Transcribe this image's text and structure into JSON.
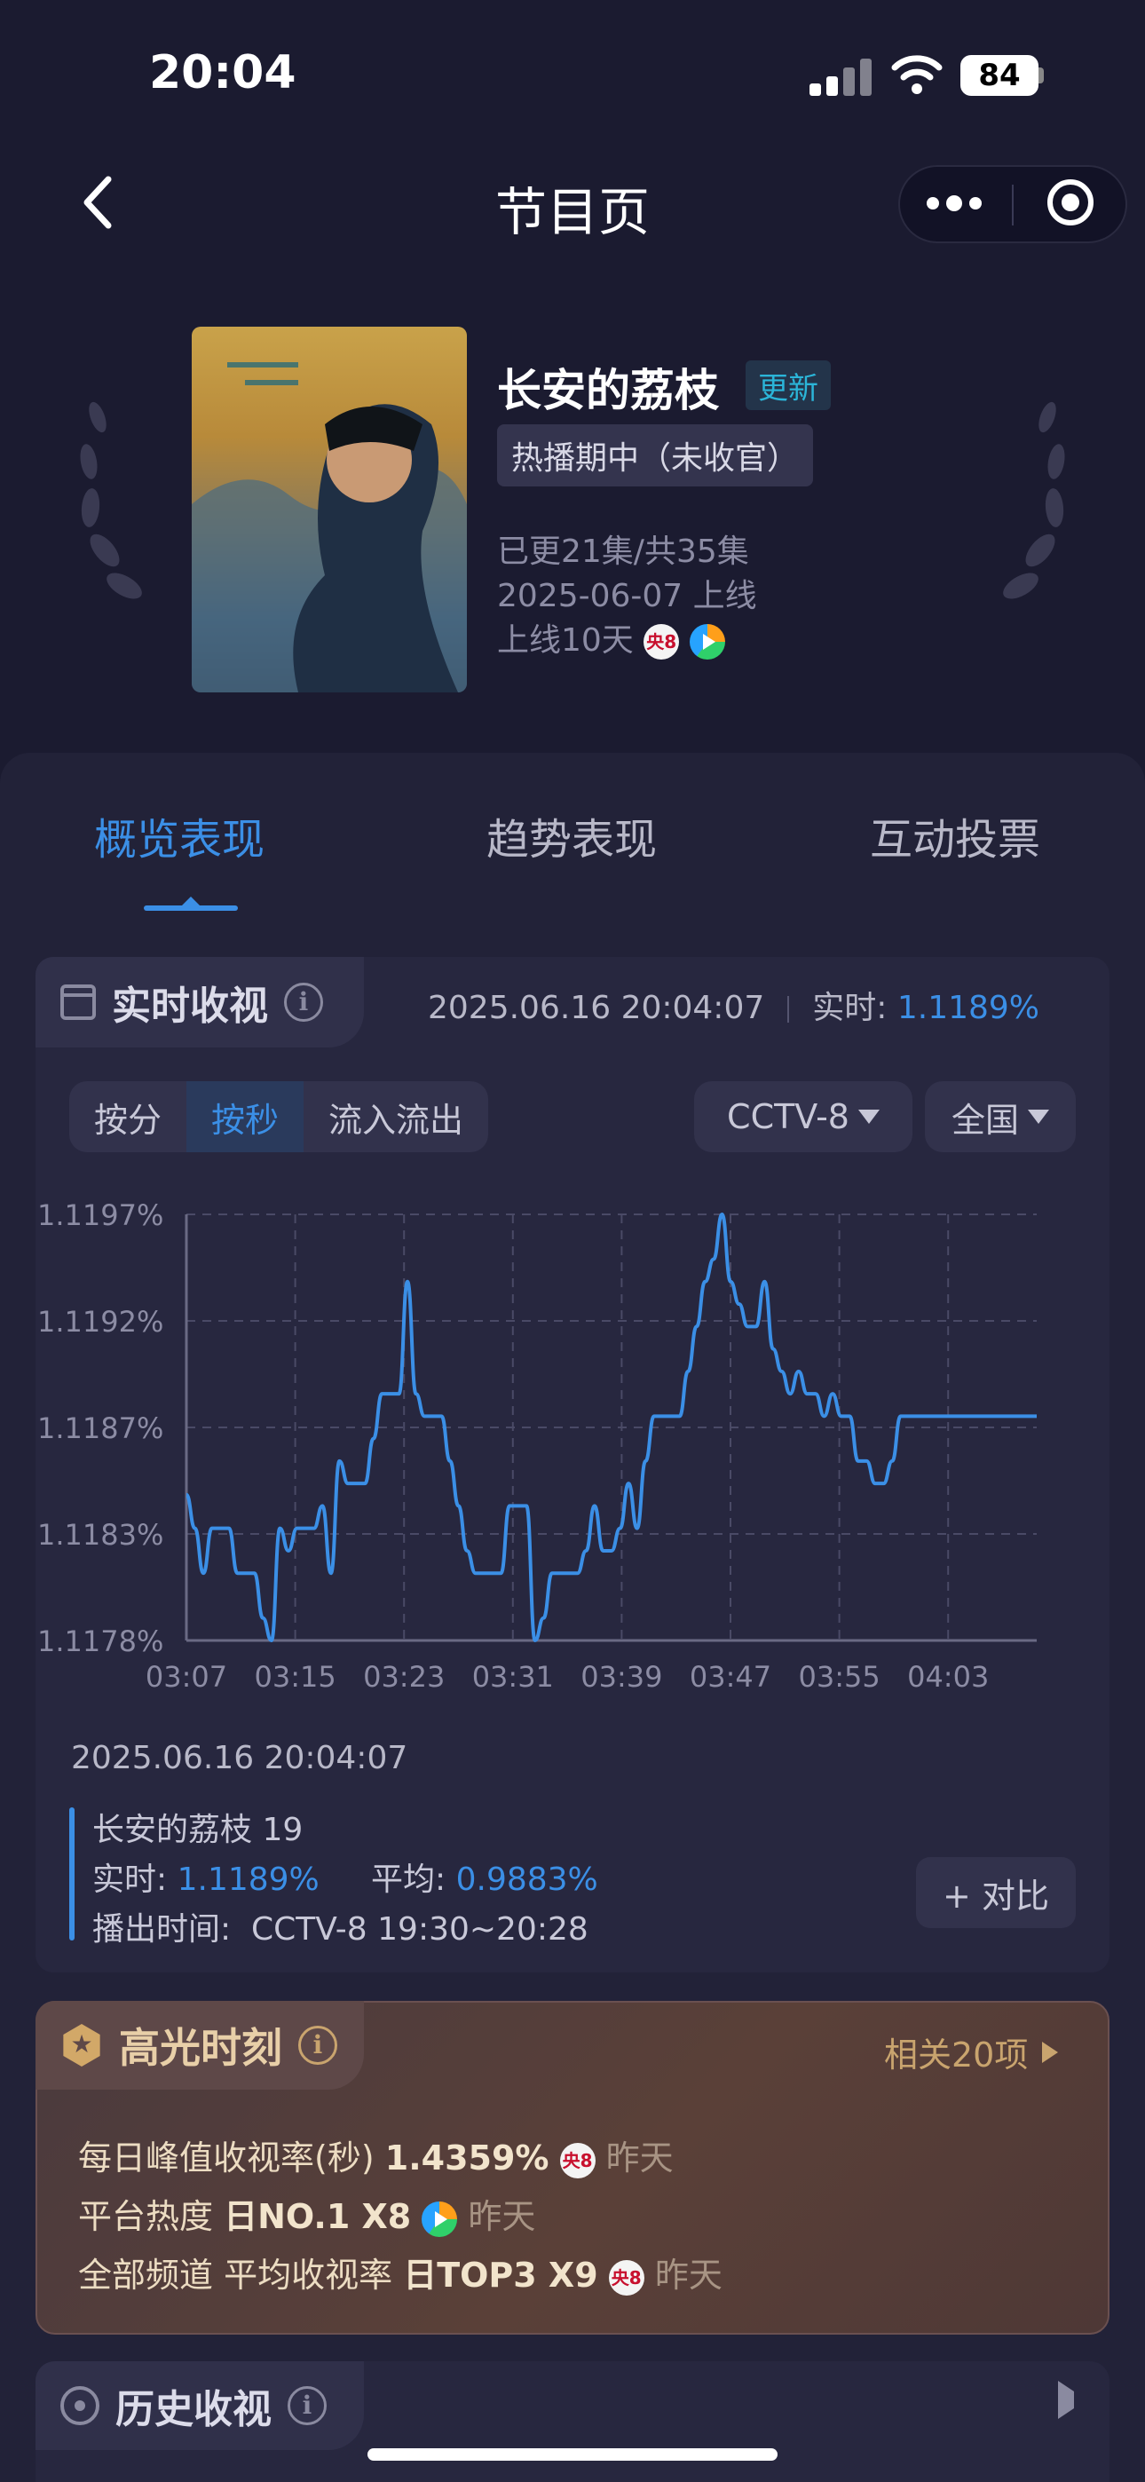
{
  "status": {
    "time": "20:04",
    "battery": "84"
  },
  "nav": {
    "title": "节目页",
    "back": "back-icon",
    "more": "more-icon",
    "target": "target-icon"
  },
  "show": {
    "title": "长安的荔枝",
    "update_tag": "更新",
    "status": "热播期中（未收官）",
    "episodes": "已更21集/共35集",
    "premiere": "2025-06-07 上线",
    "days": "上线10天",
    "channel_badge": "央8"
  },
  "tabs": [
    "概览表现",
    "趋势表现",
    "互动投票"
  ],
  "realtime": {
    "title": "实时收视",
    "datetime": "2025.06.16 20:04:07",
    "label": "实时:",
    "value": "1.1189%"
  },
  "controls": {
    "segments": [
      "按分",
      "按秒",
      "流入流出"
    ],
    "active_segment": "按秒",
    "channel": "CCTV-8",
    "region": "全国"
  },
  "chart_data": {
    "type": "line",
    "y_ticks": [
      "1.1197%",
      "1.1192%",
      "1.1187%",
      "1.1183%",
      "1.1178%"
    ],
    "x_ticks": [
      "03:07",
      "03:15",
      "03:23",
      "03:31",
      "03:39",
      "03:47",
      "03:55",
      "04:03"
    ],
    "ylim": [
      1.1178,
      1.1197
    ],
    "xlim": [
      3.07,
      4.07
    ],
    "grid": true,
    "color": "#3b8fe6",
    "series": [
      {
        "x": [
          3.07,
          3.08,
          3.09,
          3.1,
          3.11,
          3.12,
          3.13,
          3.14,
          3.15,
          3.16,
          3.17,
          3.18,
          3.19,
          3.2,
          3.21,
          3.22,
          3.23,
          3.24,
          3.25,
          3.26,
          3.27,
          3.28,
          3.29,
          3.3,
          3.31,
          3.32,
          3.33,
          3.34,
          3.35,
          3.36,
          3.37,
          3.38,
          3.39,
          3.4,
          3.41,
          3.42,
          3.43,
          3.44,
          3.45,
          3.46,
          3.47,
          3.48,
          3.49,
          3.5,
          3.51,
          3.52,
          3.53,
          3.54,
          3.55,
          3.56,
          3.57,
          3.58,
          3.59,
          3.6,
          3.61,
          3.62,
          3.63,
          3.64,
          3.65,
          3.66,
          3.67,
          3.68,
          3.69,
          3.7,
          3.71,
          3.72,
          3.73,
          3.74,
          3.75,
          3.76,
          3.77,
          3.78,
          3.79,
          3.8,
          3.81,
          3.82,
          3.83,
          3.84,
          3.85,
          3.86,
          3.87,
          3.88,
          3.89,
          3.9,
          3.91,
          3.92,
          3.93,
          3.94,
          3.95,
          3.96,
          3.97,
          3.98,
          3.99,
          4.0,
          4.01,
          4.02,
          4.03,
          4.04,
          4.05,
          4.06,
          4.07
        ],
        "y": [
          1.11845,
          1.1183,
          1.1181,
          1.1183,
          1.1183,
          1.1183,
          1.1181,
          1.1181,
          1.1181,
          1.1179,
          1.1178,
          1.1183,
          1.1182,
          1.1183,
          1.1183,
          1.1183,
          1.1184,
          1.1181,
          1.1186,
          1.1185,
          1.1185,
          1.1185,
          1.1187,
          1.1189,
          1.1189,
          1.1189,
          1.1194,
          1.1189,
          1.1188,
          1.1188,
          1.1188,
          1.1186,
          1.1184,
          1.1182,
          1.1181,
          1.1181,
          1.1181,
          1.1181,
          1.1184,
          1.1184,
          1.1184,
          1.1178,
          1.1179,
          1.1181,
          1.1181,
          1.1181,
          1.1181,
          1.1182,
          1.1184,
          1.1182,
          1.1182,
          1.1183,
          1.1185,
          1.1183,
          1.1186,
          1.1188,
          1.1188,
          1.1188,
          1.1188,
          1.119,
          1.1192,
          1.1194,
          1.1195,
          1.1197,
          1.1194,
          1.1193,
          1.1192,
          1.1192,
          1.1194,
          1.1191,
          1.119,
          1.1189,
          1.119,
          1.1189,
          1.1189,
          1.1188,
          1.1189,
          1.1188,
          1.1188,
          1.1186,
          1.1186,
          1.1185,
          1.1185,
          1.1186,
          1.1188,
          1.1188,
          1.1188,
          1.1188,
          1.1188,
          1.1188,
          1.1188,
          1.1188,
          1.1188,
          1.1188,
          1.1188,
          1.1188,
          1.1188,
          1.1188,
          1.1188,
          1.1188,
          1.1188
        ]
      }
    ]
  },
  "detail": {
    "datetime": "2025.06.16 20:04:07",
    "episode": "长安的荔枝 19",
    "realtime_label": "实时:",
    "realtime_value": "1.1189%",
    "avg_label": "平均:",
    "avg_value": "0.9883%",
    "airtime": "播出时间:  CCTV-8 19:30~20:28",
    "compare": "+ 对比"
  },
  "highlights": {
    "title": "高光时刻",
    "more": "相关20项",
    "rows": [
      {
        "label": "每日峰值收视率(秒)",
        "value": "1.4359%",
        "badge": "央8",
        "when": "昨天"
      },
      {
        "label": "平台热度",
        "value": "日NO.1 X8",
        "badge": "play",
        "when": "昨天"
      },
      {
        "label": "全部频道 平均收视率",
        "value": "日TOP3 X9",
        "badge": "央8",
        "when": "昨天"
      }
    ]
  },
  "history": {
    "title": "历史收视"
  }
}
